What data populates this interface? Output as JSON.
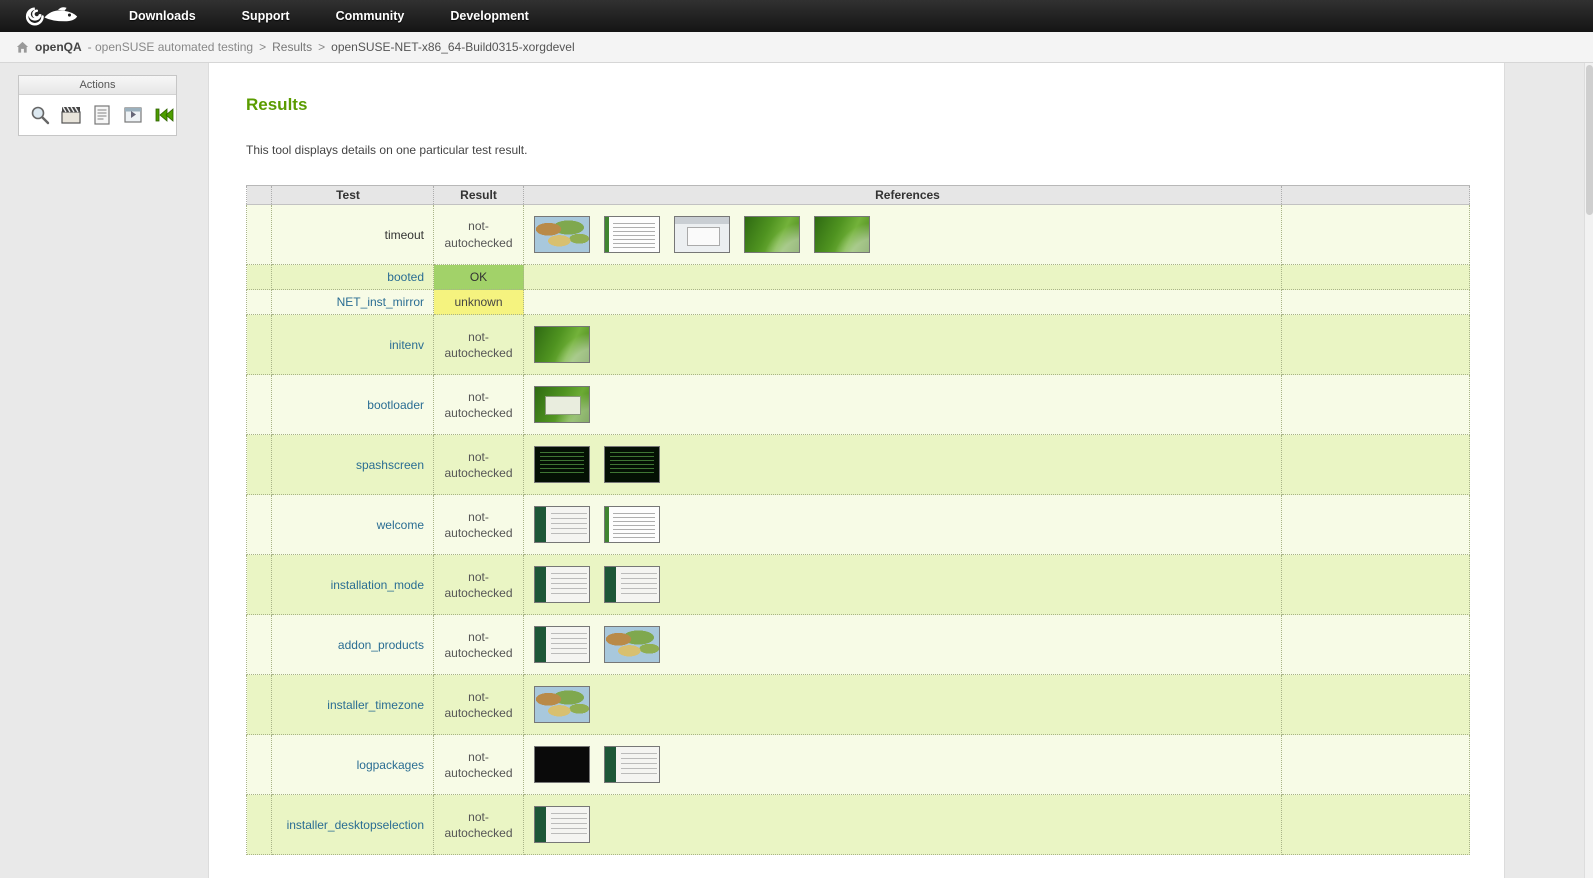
{
  "topnav": {
    "items": [
      "Downloads",
      "Support",
      "Community",
      "Development"
    ]
  },
  "breadcrumb": {
    "site": "openQA",
    "site_suffix": "- openSUSE automated testing",
    "sep1": ">",
    "results_crumb": "Results",
    "sep2": ">",
    "build_crumb": "openSUSE-NET-x86_64-Build0315-xorgdevel"
  },
  "actions": {
    "title": "Actions",
    "icons": [
      "magnifier-icon",
      "film-clapper-icon",
      "log-file-icon",
      "export-window-icon",
      "back-arrow-icon"
    ]
  },
  "main": {
    "title": "Results",
    "description": "This tool displays details on one particular test result.",
    "table": {
      "headers": [
        "Test",
        "Result",
        "References"
      ],
      "rows": [
        {
          "test": "timeout",
          "is_link": false,
          "result": "not-autochecked",
          "result_class": "na",
          "thumbs": [
            "map",
            "textdoc",
            "window",
            "wallpaper",
            "wallpaper"
          ]
        },
        {
          "test": "booted",
          "is_link": true,
          "result": "OK",
          "result_class": "ok",
          "thumbs": []
        },
        {
          "test": "NET_inst_mirror",
          "is_link": true,
          "result": "unknown",
          "result_class": "unknown",
          "thumbs": []
        },
        {
          "test": "initenv",
          "is_link": true,
          "result": "not-autochecked",
          "result_class": "na",
          "thumbs": [
            "wallpaper"
          ]
        },
        {
          "test": "bootloader",
          "is_link": true,
          "result": "not-autochecked",
          "result_class": "na",
          "thumbs": [
            "bootmenu"
          ]
        },
        {
          "test": "spashscreen",
          "is_link": true,
          "result": "not-autochecked",
          "result_class": "na",
          "thumbs": [
            "console",
            "console"
          ]
        },
        {
          "test": "welcome",
          "is_link": true,
          "result": "not-autochecked",
          "result_class": "na",
          "thumbs": [
            "installer",
            "textdoc"
          ]
        },
        {
          "test": "installation_mode",
          "is_link": true,
          "result": "not-autochecked",
          "result_class": "na",
          "thumbs": [
            "installer",
            "installer"
          ]
        },
        {
          "test": "addon_products",
          "is_link": true,
          "result": "not-autochecked",
          "result_class": "na",
          "thumbs": [
            "installer",
            "map"
          ]
        },
        {
          "test": "installer_timezone",
          "is_link": true,
          "result": "not-autochecked",
          "result_class": "na",
          "thumbs": [
            "map"
          ]
        },
        {
          "test": "logpackages",
          "is_link": true,
          "result": "not-autochecked",
          "result_class": "na",
          "thumbs": [
            "black",
            "installer"
          ]
        },
        {
          "test": "installer_desktopselection",
          "is_link": true,
          "result": "not-autochecked",
          "result_class": "na",
          "thumbs": [
            "installer"
          ]
        }
      ]
    }
  },
  "colors": {
    "heading_green": "#5b9c00",
    "link_blue": "#2a6d93",
    "ok_green": "#a2d269",
    "unknown_yellow": "#f5f37f",
    "row_pale": "#f7fbe6",
    "row_dark": "#eaf5c4",
    "topbar_dark": "#1b1b1b"
  }
}
